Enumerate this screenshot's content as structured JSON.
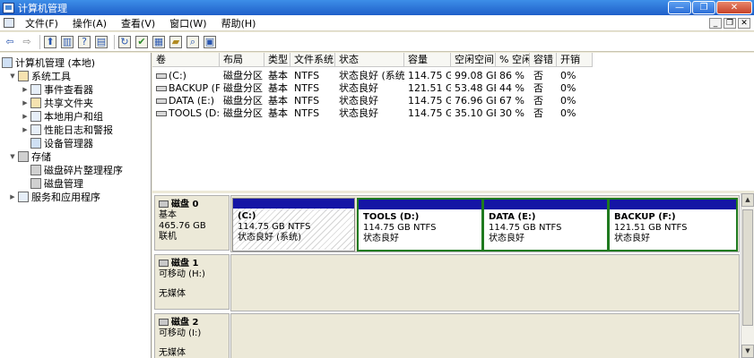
{
  "window": {
    "title": "计算机管理"
  },
  "menu": [
    "文件(F)",
    "操作(A)",
    "查看(V)",
    "窗口(W)",
    "帮助(H)"
  ],
  "tree": [
    {
      "label": "计算机管理 (本地)",
      "level": 0,
      "icon": "computer-icon",
      "expand": ""
    },
    {
      "label": "系统工具",
      "level": 1,
      "icon": "tools-icon",
      "expand": "▼"
    },
    {
      "label": "事件查看器",
      "level": 2,
      "icon": "event-viewer-icon",
      "expand": "▶"
    },
    {
      "label": "共享文件夹",
      "level": 2,
      "icon": "shared-folder-icon",
      "expand": "▶"
    },
    {
      "label": "本地用户和组",
      "level": 2,
      "icon": "users-icon",
      "expand": "▶"
    },
    {
      "label": "性能日志和警报",
      "level": 2,
      "icon": "performance-icon",
      "expand": "▶"
    },
    {
      "label": "设备管理器",
      "level": 2,
      "icon": "device-manager-icon",
      "expand": ""
    },
    {
      "label": "存储",
      "level": 1,
      "icon": "storage-icon",
      "expand": "▼"
    },
    {
      "label": "磁盘碎片整理程序",
      "level": 2,
      "icon": "defrag-icon",
      "expand": ""
    },
    {
      "label": "磁盘管理",
      "level": 2,
      "icon": "disk-management-icon",
      "expand": ""
    },
    {
      "label": "服务和应用程序",
      "level": 1,
      "icon": "services-icon",
      "expand": "▶"
    }
  ],
  "columns": [
    "卷",
    "布局",
    "类型",
    "文件系统",
    "状态",
    "容量",
    "空闲空间",
    "% 空闲",
    "容错",
    "开销"
  ],
  "volumes": [
    [
      "(C:)",
      "磁盘分区",
      "基本",
      "NTFS",
      "状态良好 (系统)",
      "114.75 GB",
      "99.08 GB",
      "86 %",
      "否",
      "0%"
    ],
    [
      "BACKUP (F:)",
      "磁盘分区",
      "基本",
      "NTFS",
      "状态良好",
      "121.51 GB",
      "53.48 GB",
      "44 %",
      "否",
      "0%"
    ],
    [
      "DATA (E:)",
      "磁盘分区",
      "基本",
      "NTFS",
      "状态良好",
      "114.75 GB",
      "76.96 GB",
      "67 %",
      "否",
      "0%"
    ],
    [
      "TOOLS (D:)",
      "磁盘分区",
      "基本",
      "NTFS",
      "状态良好",
      "114.75 GB",
      "35.10 GB",
      "30 %",
      "否",
      "0%"
    ]
  ],
  "disks": [
    {
      "name": "磁盘 0",
      "type": "基本",
      "size": "465.76 GB",
      "status": "联机",
      "partitions": [
        {
          "name": "(C:)",
          "size": "114.75 GB NTFS",
          "status": "状态良好 (系统)"
        },
        {
          "name": "TOOLS  (D:)",
          "size": "114.75 GB NTFS",
          "status": "状态良好"
        },
        {
          "name": "DATA  (E:)",
          "size": "114.75 GB NTFS",
          "status": "状态良好"
        },
        {
          "name": "BACKUP  (F:)",
          "size": "121.51 GB NTFS",
          "status": "状态良好"
        }
      ]
    },
    {
      "name": "磁盘 1",
      "type": "可移动 (H:)",
      "size": "",
      "status": "无媒体"
    },
    {
      "name": "磁盘 2",
      "type": "可移动 (I:)",
      "size": "",
      "status": "无媒体"
    }
  ]
}
